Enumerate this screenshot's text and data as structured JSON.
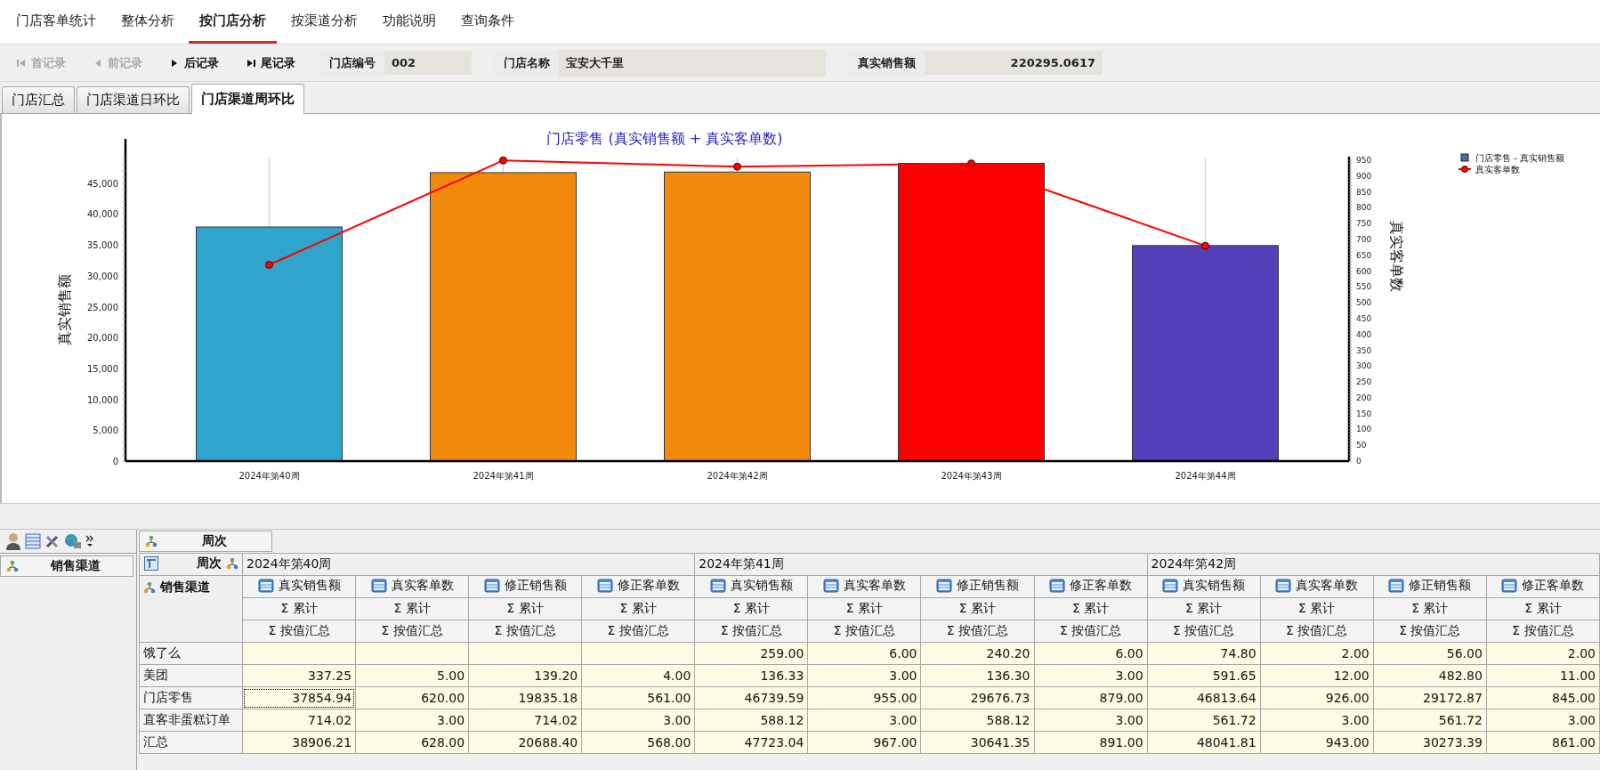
{
  "main_tabs": [
    {
      "label": "门店客单统计",
      "selected": false
    },
    {
      "label": "整体分析",
      "selected": false
    },
    {
      "label": "按门店分析",
      "selected": true
    },
    {
      "label": "按渠道分析",
      "selected": false
    },
    {
      "label": "功能说明",
      "selected": false
    },
    {
      "label": "查询条件",
      "selected": false
    }
  ],
  "record_nav": [
    {
      "kind": "first",
      "label": "首记录",
      "disabled": true
    },
    {
      "kind": "prev",
      "label": "前记录",
      "disabled": true
    },
    {
      "kind": "next",
      "label": "后记录",
      "disabled": false
    },
    {
      "kind": "last",
      "label": "尾记录",
      "disabled": false
    }
  ],
  "fields": [
    {
      "label": "门店编号",
      "value": "002",
      "kind": "text"
    },
    {
      "label": "门店名称",
      "value": "宝安大千里",
      "kind": "text"
    },
    {
      "label": "真实销售额",
      "value": "220295.0617",
      "kind": "amount"
    }
  ],
  "sub_tabs": [
    {
      "label": "门店汇总",
      "selected": false
    },
    {
      "label": "门店渠道日环比",
      "selected": false
    },
    {
      "label": "门店渠道周环比",
      "selected": true
    }
  ],
  "chart": {
    "legend_swatch": {
      "color": "#4a6c9b"
    },
    "chart_data": {
      "type": "bar",
      "title": "门店零售 (真实销售额 + 真实客单数)",
      "ylabel": "真实销售额",
      "y2label": "真实客单数",
      "categories": [
        "2024年第40周",
        "2024年第41周",
        "2024年第42周",
        "2024年第43周",
        "2024年第44周"
      ],
      "series": [
        {
          "name": "门店零售 - 真实销售额",
          "type": "bar",
          "colors": [
            "#2fa5cd",
            "#f28b0b",
            "#f28b0b",
            "#ff0000",
            "#5540ba"
          ],
          "values": [
            37900,
            46700,
            46800,
            48200,
            34900
          ]
        },
        {
          "name": "真实客单数",
          "color": "#ff0000",
          "type": "line",
          "axis": "y2",
          "marker": "circle",
          "values": [
            620,
            950,
            930,
            940,
            680
          ]
        }
      ],
      "grid": true,
      "ylim": [
        0,
        49000
      ],
      "y2lim": [
        0,
        956
      ],
      "yticks": [
        {
          "value": 0,
          "label": "0"
        },
        {
          "value": 5000,
          "label": "5,000"
        },
        {
          "value": 10000,
          "label": "10,000"
        },
        {
          "value": 15000,
          "label": "15,000"
        },
        {
          "value": 20000,
          "label": "20,000"
        },
        {
          "value": 25000,
          "label": "25,000"
        },
        {
          "value": 30000,
          "label": "30,000"
        },
        {
          "value": 35000,
          "label": "35,000"
        },
        {
          "value": 40000,
          "label": "40,000"
        },
        {
          "value": 45000,
          "label": "45,000"
        }
      ],
      "y2ticks": [
        0,
        50,
        100,
        150,
        200,
        250,
        300,
        350,
        400,
        450,
        500,
        550,
        600,
        650,
        700,
        750,
        800,
        850,
        900,
        950
      ]
    }
  },
  "pivot": {
    "column_field": "周次",
    "row_field": "销售渠道",
    "corner_column_label": "周次",
    "corner_row_label": "销售渠道",
    "weeks": [
      {
        "label": "2024年第40周",
        "measures": [
          {
            "label": "真实销售额",
            "sum": "Σ 累计",
            "agg": "Σ 按值汇总"
          },
          {
            "label": "真实客单数",
            "sum": "Σ 累计",
            "agg": "Σ 按值汇总"
          },
          {
            "label": "修正销售额",
            "sum": "Σ 累计",
            "agg": "Σ 按值汇总"
          },
          {
            "label": "修正客单数",
            "sum": "Σ 累计",
            "agg": "Σ 按值汇总"
          }
        ]
      },
      {
        "label": "2024年第41周",
        "measures": [
          {
            "label": "真实销售额",
            "sum": "Σ 累计",
            "agg": "Σ 按值汇总"
          },
          {
            "label": "真实客单数",
            "sum": "Σ 累计",
            "agg": "Σ 按值汇总"
          },
          {
            "label": "修正销售额",
            "sum": "Σ 累计",
            "agg": "Σ 按值汇总"
          },
          {
            "label": "修正客单数",
            "sum": "Σ 累计",
            "agg": "Σ 按值汇总"
          }
        ]
      },
      {
        "label": "2024年第42周",
        "measures": [
          {
            "label": "真实销售额",
            "sum": "Σ 累计",
            "agg": "Σ 按值汇总"
          },
          {
            "label": "真实客单数",
            "sum": "Σ 累计",
            "agg": "Σ 按值汇总"
          },
          {
            "label": "修正销售额",
            "sum": "Σ 累计",
            "agg": "Σ 按值汇总"
          },
          {
            "label": "修正客单数",
            "sum": "Σ 累计",
            "agg": "Σ 按值汇总"
          }
        ]
      }
    ],
    "rows": [
      {
        "label": "饿了么",
        "focused": false,
        "values": [
          {
            "empty": true
          },
          {
            "empty": true
          },
          {
            "empty": true
          },
          {
            "empty": true
          },
          "259.00",
          "6.00",
          "240.20",
          "6.00",
          "74.80",
          "2.00",
          "56.00",
          "2.00"
        ]
      },
      {
        "label": "美团",
        "focused": false,
        "values": [
          "337.25",
          "5.00",
          "139.20",
          "4.00",
          "136.33",
          "3.00",
          "136.30",
          "3.00",
          "591.65",
          "12.00",
          "482.80",
          "11.00"
        ]
      },
      {
        "label": "门店零售",
        "focused": true,
        "values": [
          "37854.94",
          "620.00",
          "19835.18",
          "561.00",
          "46739.59",
          "955.00",
          "29676.73",
          "879.00",
          "46813.64",
          "926.00",
          "29172.87",
          "845.00"
        ]
      },
      {
        "label": "直客非蛋糕订单",
        "focused": false,
        "values": [
          "714.02",
          "3.00",
          "714.02",
          "3.00",
          "588.12",
          "3.00",
          "588.12",
          "3.00",
          "561.72",
          "3.00",
          "561.72",
          "3.00"
        ]
      },
      {
        "label": "汇总",
        "focused": false,
        "values": [
          "38906.21",
          "628.00",
          "20688.40",
          "568.00",
          "47723.04",
          "967.00",
          "30641.35",
          "891.00",
          "48041.81",
          "943.00",
          "30273.39",
          "861.00"
        ]
      }
    ]
  }
}
